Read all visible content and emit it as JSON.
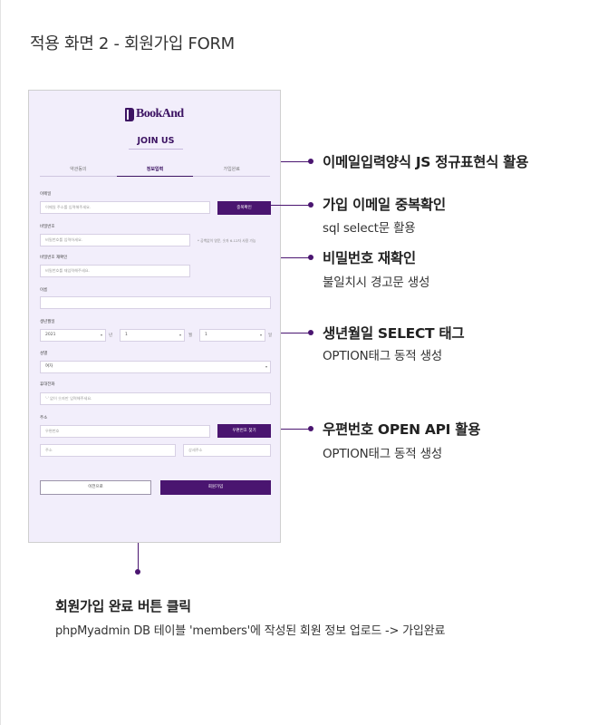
{
  "page": {
    "title": "적용 화면 2 - 회원가입 FORM"
  },
  "mockup": {
    "logo_text": "BookAnd",
    "join_title": "JOIN US",
    "steps": [
      "약관동의",
      "정보입력",
      "가입완료"
    ],
    "email": {
      "label": "이메일",
      "placeholder": "이메일 주소를 입력해주세요.",
      "button": "중복확인"
    },
    "password": {
      "label": "비밀번호",
      "placeholder": "비밀번호를 입력하세요.",
      "hint": "* 공백없이 영문, 숫자 6-12자 사용 가능"
    },
    "password_confirm": {
      "label": "비밀번호 재확인",
      "placeholder": "비밀번호를 재입력해주세요."
    },
    "name": {
      "label": "이름",
      "value": ""
    },
    "birth": {
      "label": "생년월일",
      "year": "2021",
      "year_unit": "년",
      "month": "1",
      "month_unit": "월",
      "day": "1",
      "day_unit": "일"
    },
    "gender": {
      "label": "성별",
      "value": "여자"
    },
    "phone": {
      "label": "휴대전화",
      "placeholder": "'-' 없이 숫자만 입력해주세요."
    },
    "address": {
      "label": "주소",
      "postcode_placeholder": "우편번호",
      "postcode_button": "우편번호 찾기",
      "addr_placeholder": "주소",
      "detail_placeholder": "상세주소"
    },
    "buttons": {
      "prev": "이전으로",
      "submit": "회원가입"
    }
  },
  "callouts": [
    {
      "title": "이메일입력양식 JS 정규표현식 활용",
      "subtitle": ""
    },
    {
      "title": "가입 이메일 중복확인",
      "subtitle": "sql select문 활용"
    },
    {
      "title": "비밀번호 재확인",
      "subtitle": "불일치시 경고문 생성"
    },
    {
      "title": "생년월일 SELECT 태그",
      "subtitle": "OPTION태그 동적 생성"
    },
    {
      "title": "우편번호 OPEN API 활용",
      "subtitle": "OPTION태그 동적 생성"
    }
  ],
  "bottom_note": {
    "title": "회원가입 완료 버튼 클릭",
    "subtitle": "phpMyadmin DB 테이블 'members'에 작성된 회원 정보 업로드 -> 가입완료"
  },
  "colors": {
    "accent": "#4a1570",
    "mockup_bg": "#f2eefb"
  }
}
